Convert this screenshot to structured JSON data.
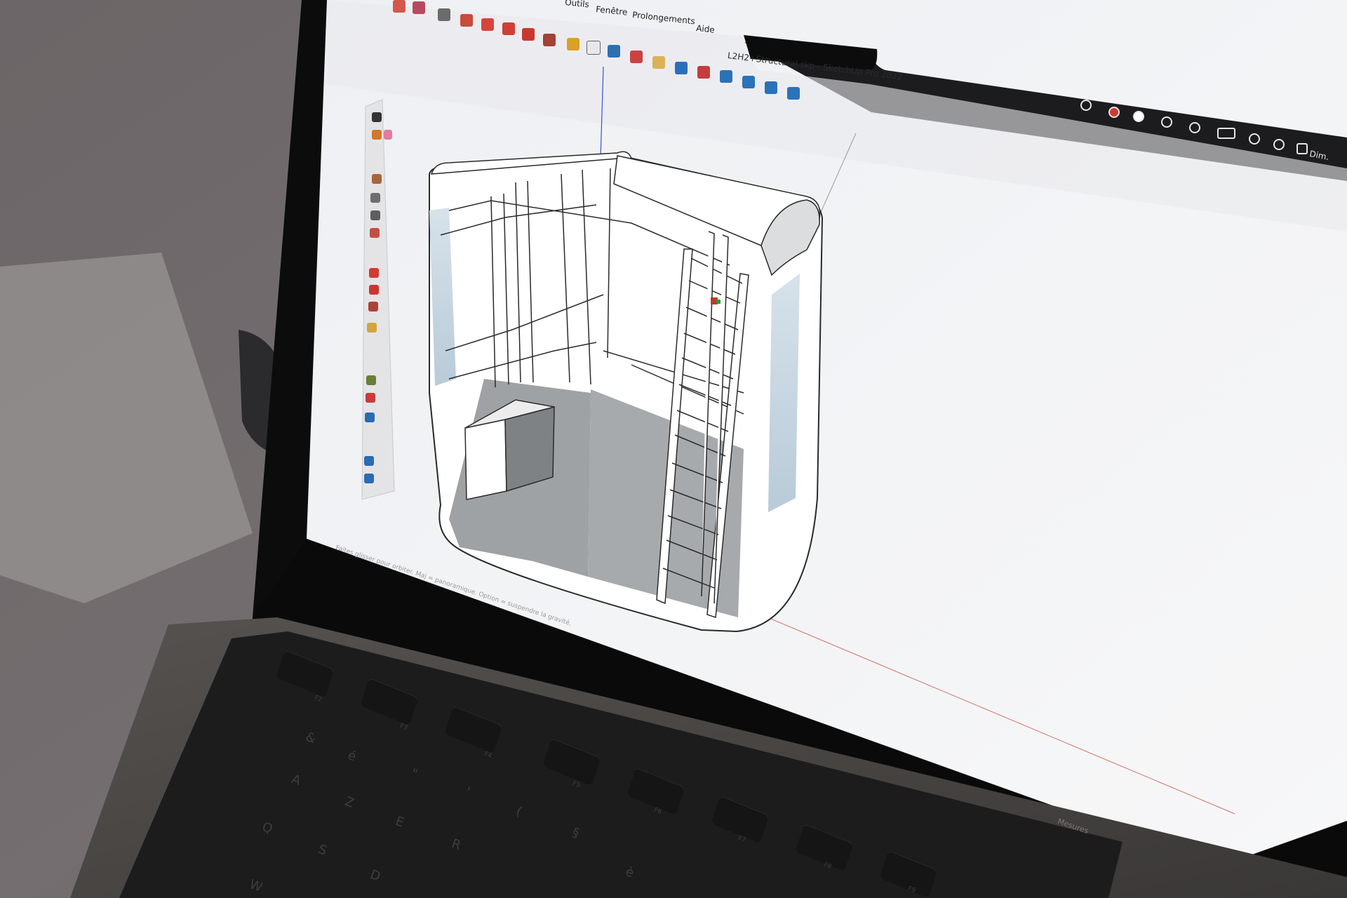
{
  "app": {
    "name": "SketchUp Pro 2022",
    "window_title": "L2H2+Structural.skp - SketchUp Pro 2022"
  },
  "menu_bar": {
    "items": [
      {
        "label": "Outils"
      },
      {
        "label": "Fenêtre"
      },
      {
        "label": "Prolongements"
      },
      {
        "label": "Aide"
      }
    ]
  },
  "macos_menubar_right": {
    "clock_label": "Dim."
  },
  "status_bar": {
    "hint_text": "Faites glisser pour orbiter. Maj = panoramique. Option = suspendre la gravité.",
    "measurements_label": "Mesures"
  },
  "keyboard": {
    "keys": [
      "A",
      "Z",
      "E",
      "R",
      "Q",
      "S",
      "D",
      "W",
      "&",
      "é",
      "\"",
      "'",
      "(",
      "§",
      "è"
    ],
    "function_keys": [
      "F2",
      "F3",
      "F4",
      "F5",
      "F6",
      "F7",
      "F8",
      "F9"
    ]
  },
  "colors": {
    "viewport_bg": "#f3f4f6",
    "menubar_dark": "#1e1e20",
    "model_fill": "#ffffff",
    "model_shade": "#8d9193",
    "model_blue_tint": "#c9d8e3",
    "axis_blue": "#3b4fd6",
    "axis_red": "#c0392b",
    "axis_green": "#2e9a3a"
  },
  "left_toolbar": {
    "icons": [
      "select-icon",
      "lasso-icon",
      "paint-bucket-icon",
      "eraser-icon",
      "line-icon",
      "freehand-icon",
      "rectangle-icon",
      "rotated-rectangle-icon",
      "circle-icon",
      "polygon-icon",
      "arc-icon",
      "pie-icon",
      "move-icon",
      "push-pull-icon",
      "rotate-icon",
      "follow-me-icon",
      "scale-icon",
      "offset-icon",
      "tape-measure-icon",
      "dimension-icon",
      "protractor-icon",
      "text-icon",
      "axes-icon",
      "3d-text-icon",
      "orbit-icon",
      "pan-icon",
      "zoom-icon",
      "zoom-window-icon",
      "zoom-extents-icon",
      "walk-icon",
      "look-around-icon",
      "section-plane-icon"
    ]
  },
  "top_toolbar": {
    "icons": [
      "select-icon",
      "pencil-icon",
      "arc-icon",
      "shape-icon",
      "push-pull-icon",
      "offset-icon",
      "move-icon",
      "rotate-icon",
      "scale-icon",
      "tape-measure-icon",
      "text-icon",
      "paint-bucket-icon",
      "orbit-icon",
      "pan-icon",
      "zoom-icon",
      "zoom-extents-icon",
      "warehouse-icon",
      "extension-icon",
      "styles-icon",
      "layers-icon"
    ]
  }
}
